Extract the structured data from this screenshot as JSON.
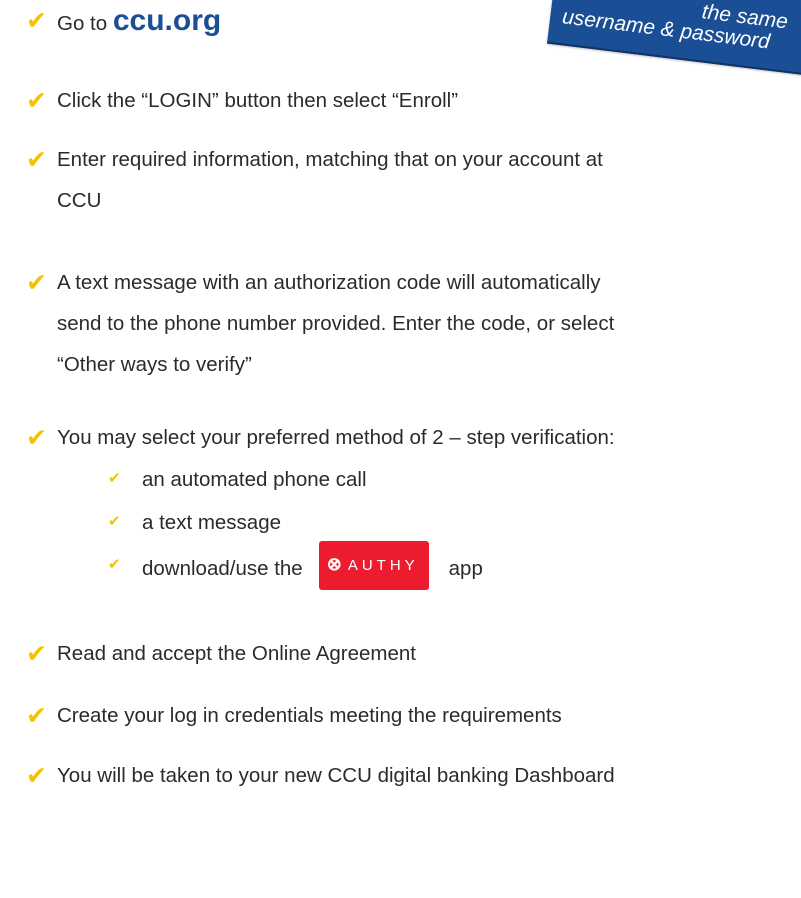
{
  "banner": {
    "line1": "the same",
    "line2": "username & password"
  },
  "steps": [
    {
      "prefix": "Go to ",
      "link": "ccu.org"
    },
    {
      "text": "Click the “LOGIN” button then select “Enroll”"
    },
    {
      "line1": "Enter required information, matching that on your account at",
      "line2": "CCU"
    },
    {
      "line1": "A text message with an authorization code will automatically",
      "line2": "send to the phone number provided. Enter the code, or select",
      "line3": "“Other ways to verify”"
    },
    {
      "text": "You may select your preferred method of 2 – step verification:"
    },
    {
      "text": "Read and accept the Online Agreement"
    },
    {
      "text": "Create your log in credentials meeting the requirements"
    },
    {
      "text": "You will be taken to your new CCU digital banking Dashboard"
    }
  ],
  "methods": [
    {
      "text": "an automated phone call"
    },
    {
      "text": "a text message"
    },
    {
      "before": "download/use the",
      "badge_logo": "⊗",
      "badge_text": "AUTHY",
      "after": "app"
    }
  ],
  "colors": {
    "check": "#f5c200",
    "brand_blue": "#1a4f96",
    "authy_red": "#ec1c2e"
  },
  "icons": {
    "step_marker": "checkmark-icon",
    "authy_logo": "authy-logo-icon"
  }
}
